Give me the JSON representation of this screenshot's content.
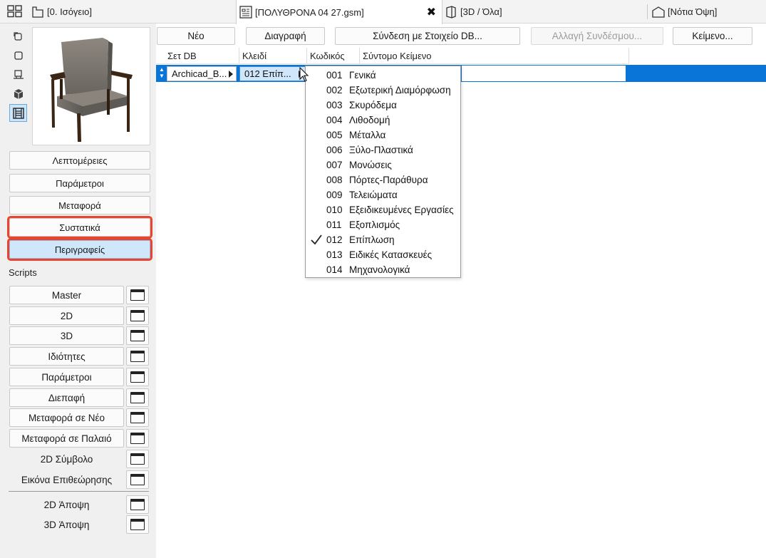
{
  "tabs": [
    {
      "label": "[0. Ισόγειο]",
      "icon": "floor-plan-icon"
    },
    {
      "label": "[ΠΟΛΥΘΡΟΝΑ 04 27.gsm]",
      "icon": "gdl-object-icon",
      "active": true
    },
    {
      "label": "[3D / Όλα]",
      "icon": "3d-view-icon"
    },
    {
      "label": "[Νότια Όψη]",
      "icon": "elevation-icon"
    }
  ],
  "left": {
    "sections": {
      "details": "Λεπτομέρειες",
      "parameters": "Παράμετροι",
      "migration": "Μεταφορά",
      "components": "Συστατικά",
      "descriptors": "Περιγραφείς"
    },
    "scripts_label": "Scripts",
    "scripts": [
      "Master",
      "2D",
      "3D",
      "Ιδιότητες",
      "Παράμετροι",
      "Διεπαφή",
      "Μεταφορά σε Νέο",
      "Μεταφορά σε Παλαιό",
      "2D Σύμβολο",
      "Εικόνα Επιθεώρησης"
    ],
    "views": [
      "2D Άποψη",
      "3D Άποψη"
    ]
  },
  "toolbar": {
    "new": "Νέο",
    "delete": "Διαγραφή",
    "link_db": "Σύνδεση με Στοιχείο DB...",
    "change_link": "Αλλαγή Συνδέσμου...",
    "text": "Κείμενο..."
  },
  "columns": {
    "set_db": "Σετ DB",
    "key": "Κλειδί",
    "code": "Κωδικός",
    "short_text": "Σύντομο Κείμενο"
  },
  "row": {
    "set_db_value": "Archicad_B...",
    "key_value": "012  Επίπ..."
  },
  "dropdown": [
    {
      "code": "001",
      "name": "Γενικά"
    },
    {
      "code": "002",
      "name": "Εξωτερική Διαμόρφωση"
    },
    {
      "code": "003",
      "name": "Σκυρόδεμα"
    },
    {
      "code": "004",
      "name": "Λιθοδομή"
    },
    {
      "code": "005",
      "name": "Μέταλλα"
    },
    {
      "code": "006",
      "name": "Ξύλο-Πλαστικά"
    },
    {
      "code": "007",
      "name": "Μονώσεις"
    },
    {
      "code": "008",
      "name": "Πόρτες-Παράθυρα"
    },
    {
      "code": "009",
      "name": "Τελειώματα"
    },
    {
      "code": "010",
      "name": "Εξειδικευμένες Εργασίες"
    },
    {
      "code": "011",
      "name": "Εξοπλισμός"
    },
    {
      "code": "012",
      "name": "Επίπλωση",
      "checked": true
    },
    {
      "code": "013",
      "name": "Ειδικές Κατασκευές"
    },
    {
      "code": "014",
      "name": "Μηχανολογικά"
    }
  ],
  "colors": {
    "selection_blue": "#0a75d8",
    "highlight_red": "#e8452c",
    "selected_button": "#cfe6fb"
  }
}
